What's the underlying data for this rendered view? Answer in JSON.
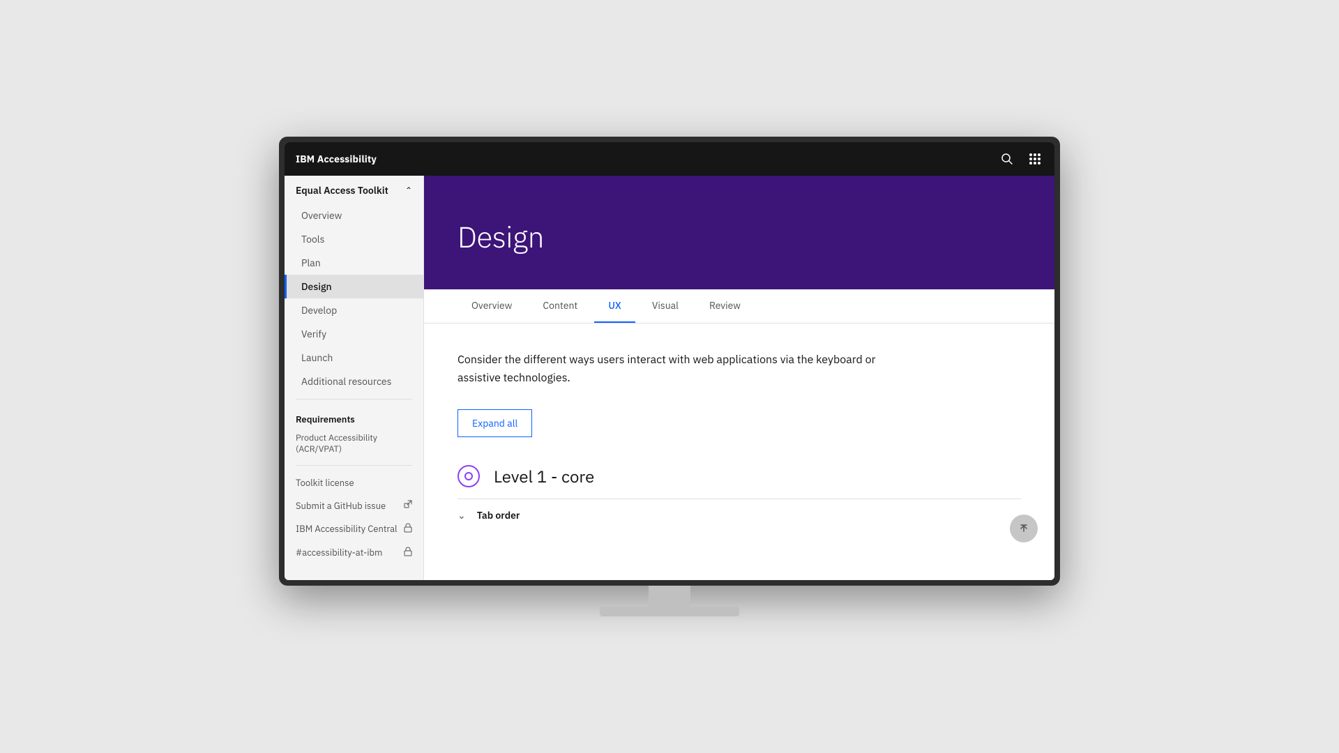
{
  "app": {
    "brand_ibm": "IBM",
    "brand_name": "Accessibility"
  },
  "topnav": {
    "search_label": "Search",
    "apps_label": "App switcher"
  },
  "sidebar": {
    "section_title": "Equal Access Toolkit",
    "nav_items": [
      {
        "label": "Overview",
        "active": false
      },
      {
        "label": "Tools",
        "active": false
      },
      {
        "label": "Plan",
        "active": false
      },
      {
        "label": "Design",
        "active": true
      },
      {
        "label": "Develop",
        "active": false
      },
      {
        "label": "Verify",
        "active": false
      },
      {
        "label": "Launch",
        "active": false
      },
      {
        "label": "Additional resources",
        "active": false
      }
    ],
    "other_sections": [
      {
        "label": "Requirements"
      },
      {
        "label": "Product Accessibility (ACR/VPAT)"
      }
    ],
    "footer_links": [
      {
        "label": "Toolkit license",
        "icon": ""
      },
      {
        "label": "Submit a GitHub issue",
        "icon": "external"
      },
      {
        "label": "IBM Accessibility Central",
        "icon": "lock"
      },
      {
        "label": "#accessibility-at-ibm",
        "icon": "lock"
      }
    ]
  },
  "hero": {
    "title": "Design"
  },
  "tabs": [
    {
      "label": "Overview",
      "active": false
    },
    {
      "label": "Content",
      "active": false
    },
    {
      "label": "UX",
      "active": true
    },
    {
      "label": "Visual",
      "active": false
    },
    {
      "label": "Review",
      "active": false
    }
  ],
  "content": {
    "intro": "Consider the different ways users interact with web applications via the keyboard or assistive technologies.",
    "expand_all": "Expand all",
    "level_title": "Level 1 - core",
    "accordion_item": "Tab order"
  }
}
